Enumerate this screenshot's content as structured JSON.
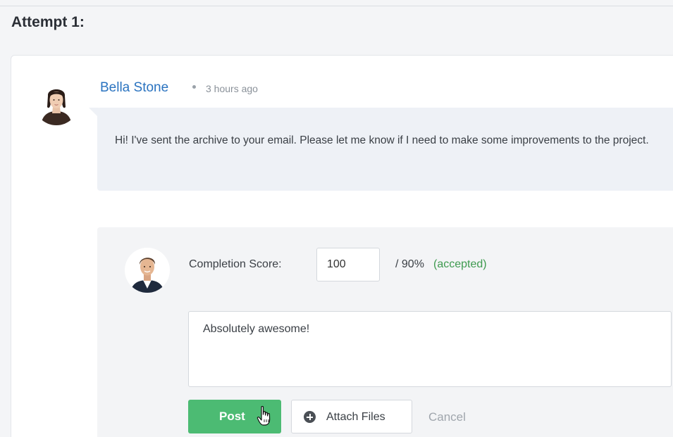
{
  "attempt": {
    "heading": "Attempt 1:"
  },
  "comment": {
    "author_name": "Bella Stone",
    "separator": "•",
    "timestamp": "3 hours ago",
    "message": "Hi! I've sent the archive to your email. Please let me know if I need to make some improvements to the project.",
    "author_avatar_icon": "female-user-avatar"
  },
  "grading": {
    "grader_avatar_icon": "male-user-avatar",
    "score_label": "Completion Score:",
    "score_value": "100",
    "score_max": "/ 90%",
    "score_status": "(accepted)",
    "feedback_value": "Absolutely awesome!",
    "post_label": "Post",
    "attach_label": "Attach Files",
    "attach_icon": "plus-circle-icon",
    "cancel_label": "Cancel",
    "cursor_icon": "hand-pointer-icon"
  },
  "colors": {
    "link": "#2a73c0",
    "accepted": "#3e9a4f",
    "post_button": "#4cbb73",
    "bubble_background": "#eef1f6"
  }
}
